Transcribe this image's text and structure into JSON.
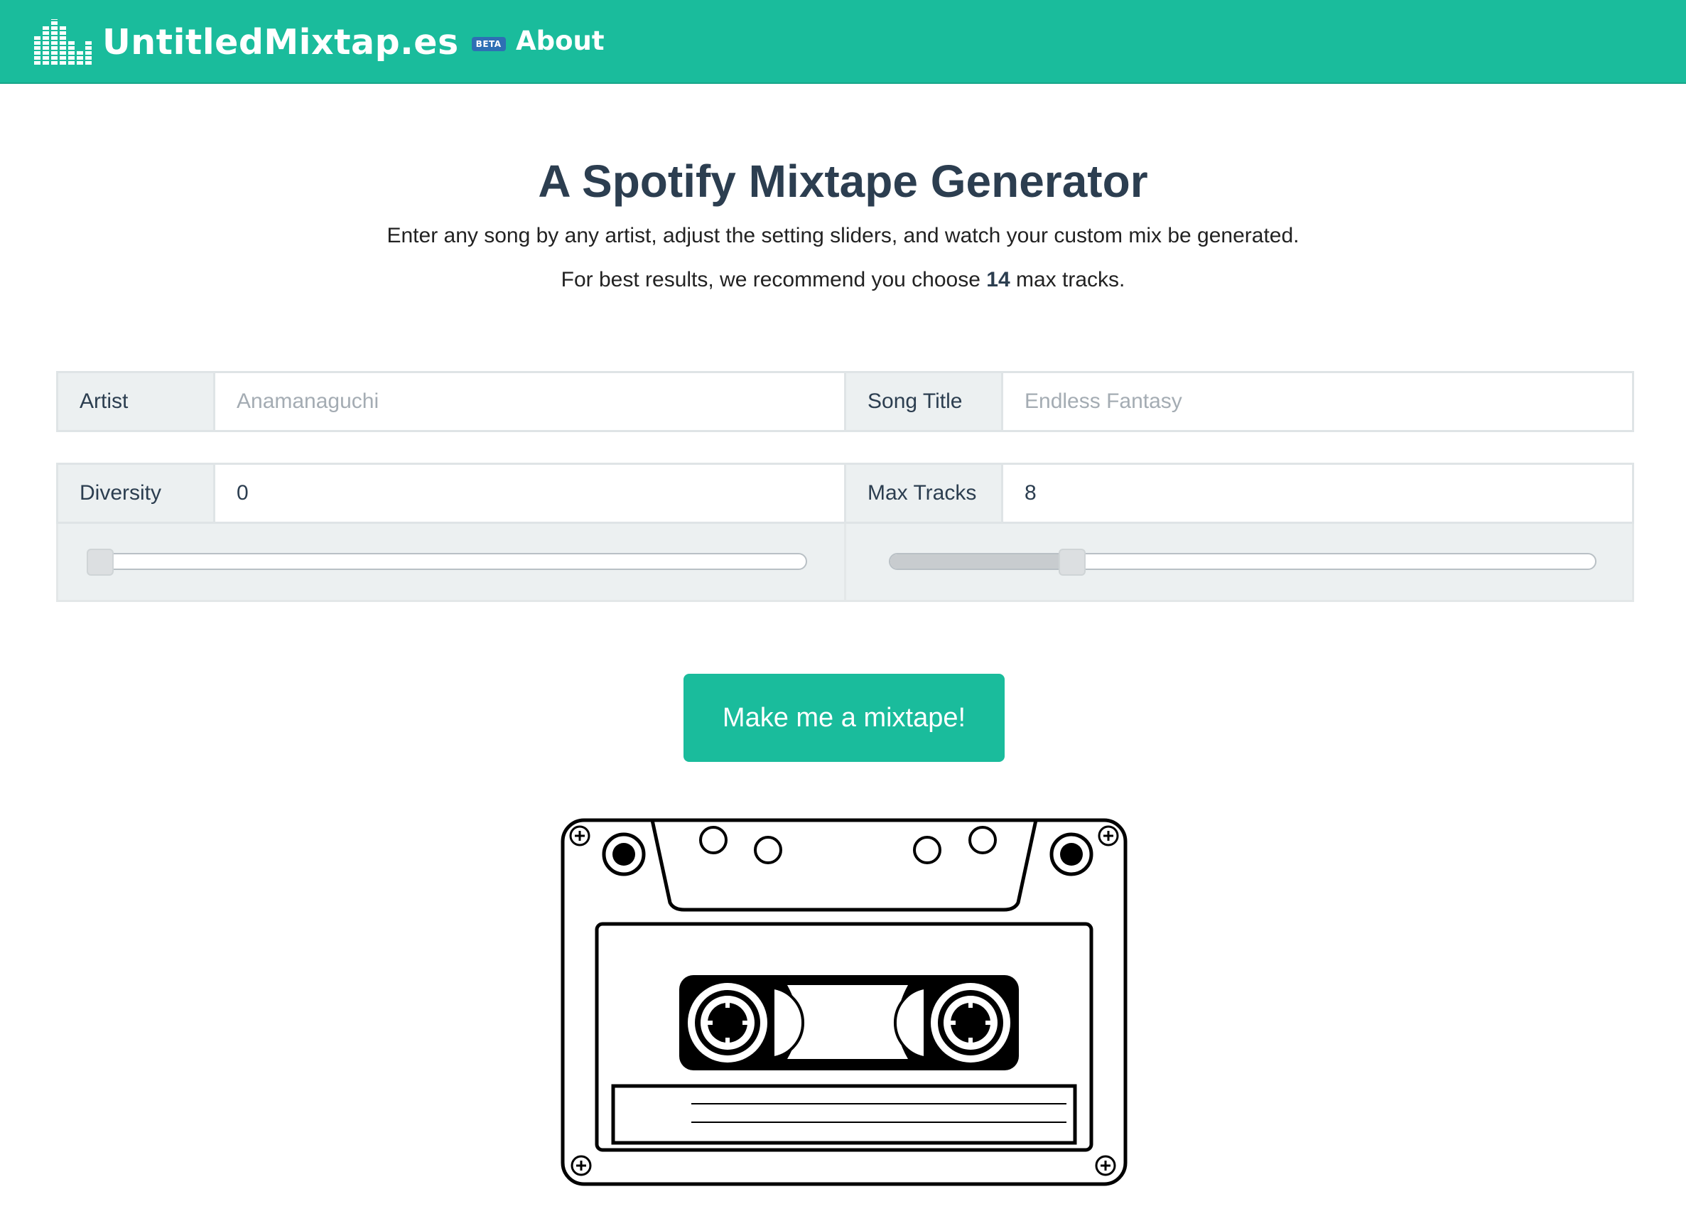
{
  "navbar": {
    "brand": "UntitledMixtap.es",
    "beta_badge": "BETA",
    "about_label": "About",
    "color": "#1abc9c"
  },
  "hero": {
    "title": "A Spotify Mixtape Generator",
    "subtitle": "Enter any song by any artist, adjust the setting sliders, and watch your custom mix be generated.",
    "recommend_prefix": "For best results, we recommend you choose",
    "recommend_count": "14",
    "recommend_suffix": "max tracks."
  },
  "form": {
    "artist": {
      "label": "Artist",
      "value": "",
      "placeholder": "Anamanaguchi"
    },
    "song_title": {
      "label": "Song Title",
      "value": "",
      "placeholder": "Endless Fantasy"
    },
    "diversity": {
      "label": "Diversity",
      "value": "0",
      "slider_fraction": 0.0
    },
    "max_tracks": {
      "label": "Max Tracks",
      "value": "8",
      "slider_fraction": 0.25
    }
  },
  "action": {
    "button_label": "Make me a mixtape!"
  },
  "icons": {
    "logo": "equalizer-bars-icon",
    "cassette": "cassette-tape-icon"
  }
}
